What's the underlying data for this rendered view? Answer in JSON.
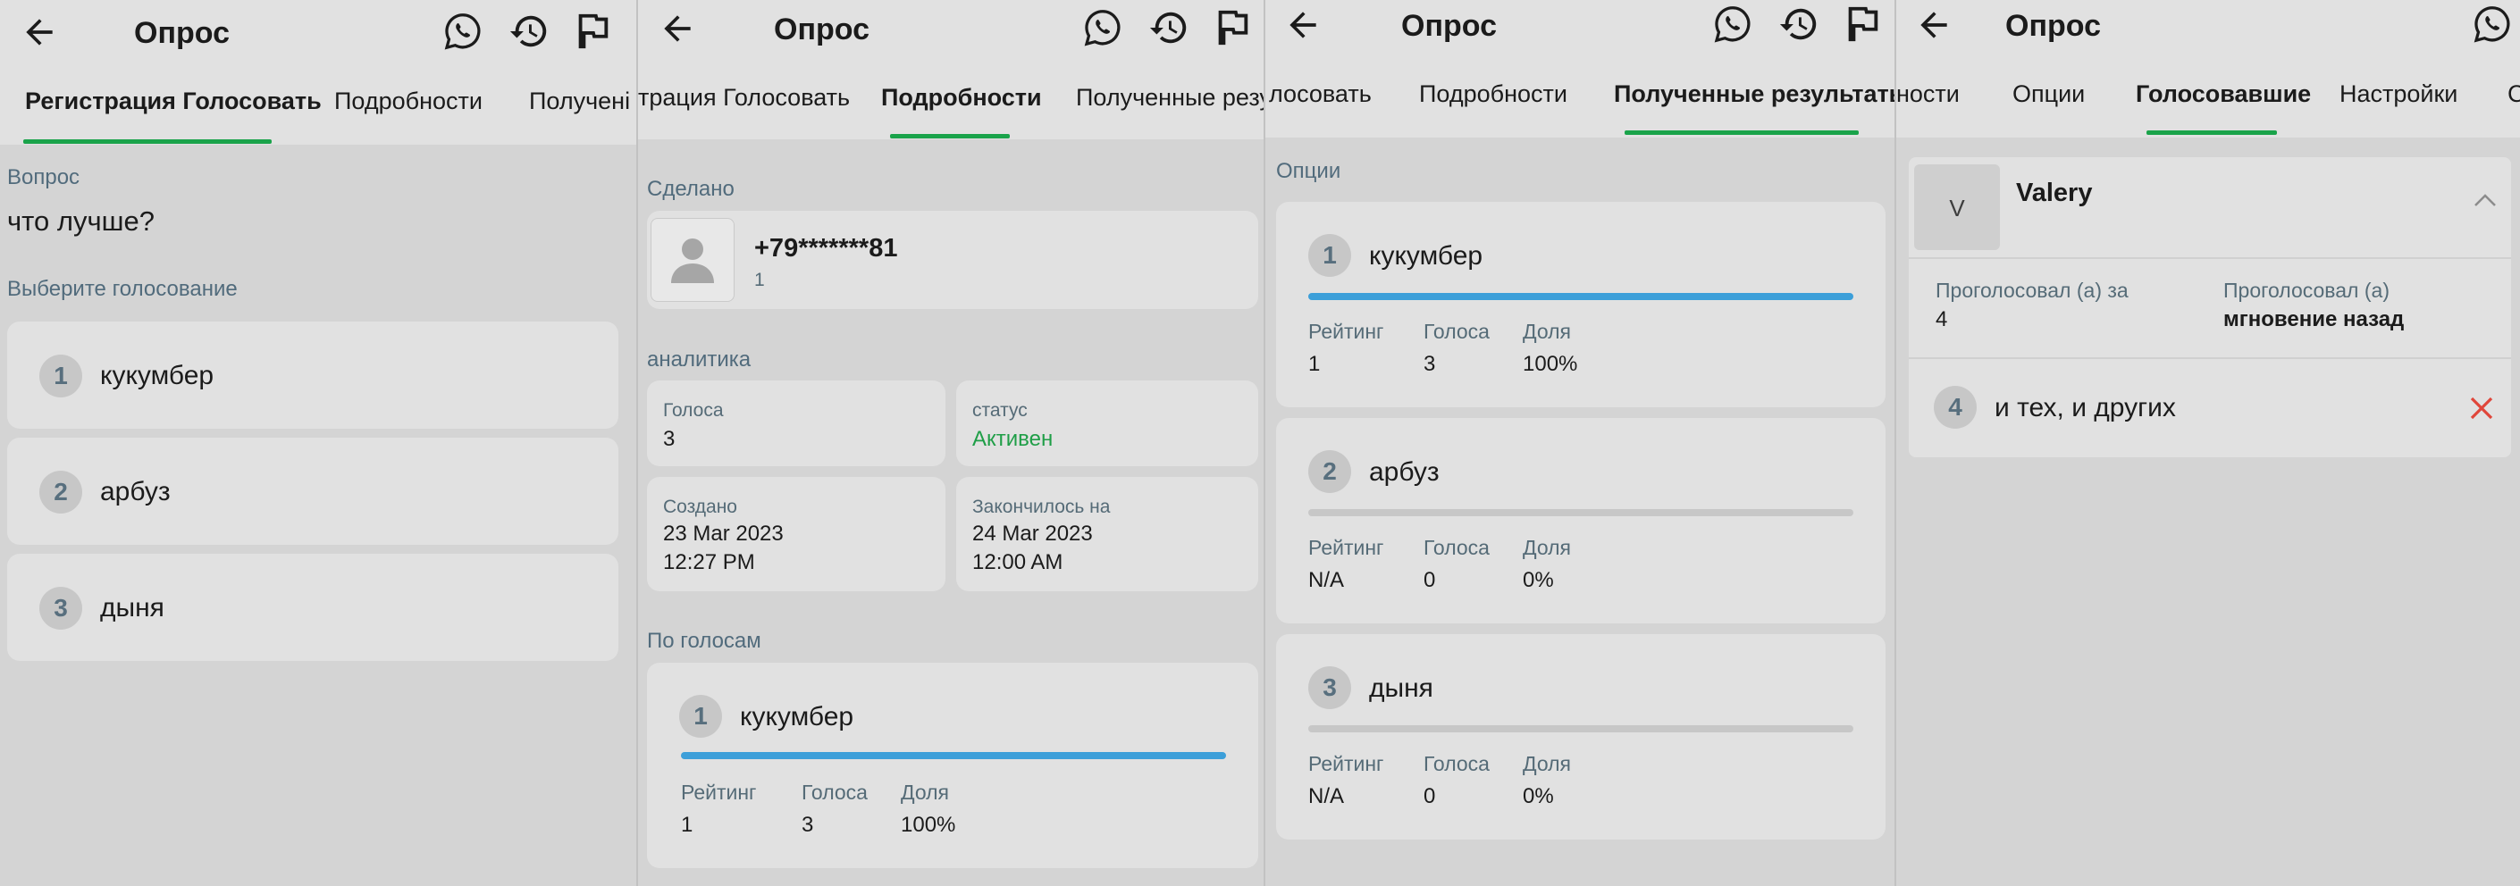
{
  "app_title": "Опрос",
  "colors": {
    "accent_green": "#1aa34a",
    "progress_blue": "#3c9fd9",
    "status_green": "#1f9e47",
    "delete_red": "#e0463a"
  },
  "icons": [
    "back-arrow-icon",
    "whatsapp-icon",
    "history-icon",
    "flag-icon",
    "person-icon",
    "chevron-up-icon",
    "close-icon"
  ],
  "panel1": {
    "tabs": [
      "Регистрация Голосовать",
      "Подробности",
      "Получені"
    ],
    "question_label": "Вопрос",
    "question": "что лучше?",
    "choose_label": "Выберите голосование",
    "options": [
      {
        "num": "1",
        "text": "кукумбер"
      },
      {
        "num": "2",
        "text": "арбуз"
      },
      {
        "num": "3",
        "text": "дыня"
      }
    ]
  },
  "panel2": {
    "tabs": [
      "трация Голосовать",
      "Подробности",
      "Полученные резул"
    ],
    "made_label": "Сделано",
    "user_phone": "+79*******81",
    "user_sub": "1",
    "analytics_label": "аналитика",
    "votes_label": "Голоса",
    "votes_value": "3",
    "status_label": "статус",
    "status_value": "Активен",
    "created_label": "Создано",
    "created_date": "23 Mar 2023",
    "created_time": "12:27 PM",
    "ended_label": "Закончилось на",
    "ended_date": "24 Mar 2023",
    "ended_time": "12:00 AM",
    "by_votes_label": "По голосам",
    "top_option": {
      "num": "1",
      "text": "кукумбер",
      "share": 1.0,
      "rating_label": "Рейтинг",
      "rating": "1",
      "votes_label": "Голоса",
      "votes": "3",
      "share_label": "Доля",
      "share_text": "100%"
    }
  },
  "panel3": {
    "tabs": [
      "лосовать",
      "Подробности",
      "Полученные результаты"
    ],
    "options_label": "Опции",
    "results": [
      {
        "num": "1",
        "text": "кукумбер",
        "share": 1.0,
        "rating_label": "Рейтинг",
        "rating": "1",
        "votes_label": "Голоса",
        "votes": "3",
        "share_label": "Доля",
        "share_text": "100%"
      },
      {
        "num": "2",
        "text": "арбуз",
        "share": 0,
        "rating_label": "Рейтинг",
        "rating": "N/A",
        "votes_label": "Голоса",
        "votes": "0",
        "share_label": "Доля",
        "share_text": "0%"
      },
      {
        "num": "3",
        "text": "дыня",
        "share": 0,
        "rating_label": "Рейтинг",
        "rating": "N/A",
        "votes_label": "Голоса",
        "votes": "0",
        "share_label": "Доля",
        "share_text": "0%"
      }
    ]
  },
  "panel4": {
    "tabs": [
      "ности",
      "Опции",
      "Голосовавшие",
      "Настройки",
      "С"
    ],
    "voter_initial": "V",
    "voter_name": "Valery",
    "voted_for_label": "Проголосовал (а) за",
    "voted_for_value": "4",
    "voted_when_label": "Проголосовал (а)",
    "voted_when_value": "мгновение назад",
    "vote": {
      "num": "4",
      "text": "и тех, и других"
    }
  }
}
